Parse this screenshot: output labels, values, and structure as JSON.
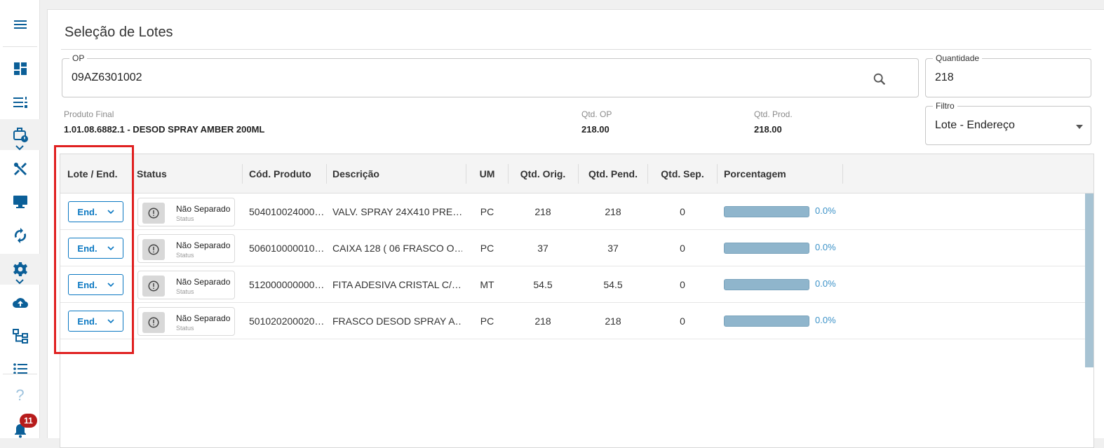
{
  "sidebar": {
    "items": [
      {
        "name": "menu-icon"
      },
      {
        "name": "dashboard-icon"
      },
      {
        "name": "list-numbered-icon"
      },
      {
        "name": "work-schedule-icon"
      },
      {
        "name": "tools-icon"
      },
      {
        "name": "monitor-icon"
      },
      {
        "name": "sync-icon"
      },
      {
        "name": "settings-gear-icon"
      },
      {
        "name": "cloud-upload-icon"
      },
      {
        "name": "hierarchy-icon"
      },
      {
        "name": "list-bullets-icon"
      },
      {
        "name": "help-icon"
      },
      {
        "name": "bell-icon"
      }
    ],
    "notification_count": "11",
    "help_glyph": "?"
  },
  "page": {
    "title": "Seleção de Lotes"
  },
  "form": {
    "op_label": "OP",
    "op_value": "09AZ6301002",
    "quantidade_label": "Quantidade",
    "quantidade_value": "218",
    "filtro_label": "Filtro",
    "filtro_value": "Lote - Endereço"
  },
  "info": {
    "produto_final_label": "Produto Final",
    "produto_final_value": "1.01.08.6882.1 - DESOD SPRAY AMBER 200ML",
    "qtd_op_label": "Qtd. OP",
    "qtd_op_value": "218.00",
    "qtd_prod_label": "Qtd. Prod.",
    "qtd_prod_value": "218.00"
  },
  "table": {
    "headers": {
      "lote": "Lote / End.",
      "status": "Status",
      "cod": "Cód. Produto",
      "desc": "Descrição",
      "um": "UM",
      "orig": "Qtd. Orig.",
      "pend": "Qtd. Pend.",
      "sep": "Qtd. Sep.",
      "pct": "Porcentagem"
    },
    "rows": [
      {
        "btn": "End.",
        "status": "Não Separado",
        "status_sub": "Status",
        "cod": "504010024000…",
        "desc": "VALV. SPRAY 24X410 PRE…",
        "um": "PC",
        "orig": "218",
        "pend": "218",
        "sep": "0",
        "pct": "0.0%",
        "progress": 0.0
      },
      {
        "btn": "End.",
        "status": "Não Separado",
        "status_sub": "Status",
        "cod": "506010000010…",
        "desc": "CAIXA 128 ( 06 FRASCO O…",
        "um": "PC",
        "orig": "37",
        "pend": "37",
        "sep": "0",
        "pct": "0.0%",
        "progress": 0.0
      },
      {
        "btn": "End.",
        "status": "Não Separado",
        "status_sub": "Status",
        "cod": "512000000000…",
        "desc": "FITA ADESIVA CRISTAL C/…",
        "um": "MT",
        "orig": "54.5",
        "pend": "54.5",
        "sep": "0",
        "pct": "0.0%",
        "progress": 0.0
      },
      {
        "btn": "End.",
        "status": "Não Separado",
        "status_sub": "Status",
        "cod": "501020200020…",
        "desc": "FRASCO DESOD SPRAY A…",
        "um": "PC",
        "orig": "218",
        "pend": "218",
        "sep": "0",
        "pct": "0.0%",
        "progress": 0.0
      }
    ]
  },
  "colors": {
    "primary": "#0b5f98",
    "accent_blue": "#0b78c2",
    "highlight_red": "#e02020",
    "progress_bar": "#8fb5cc",
    "badge_red": "#b71c1c"
  }
}
